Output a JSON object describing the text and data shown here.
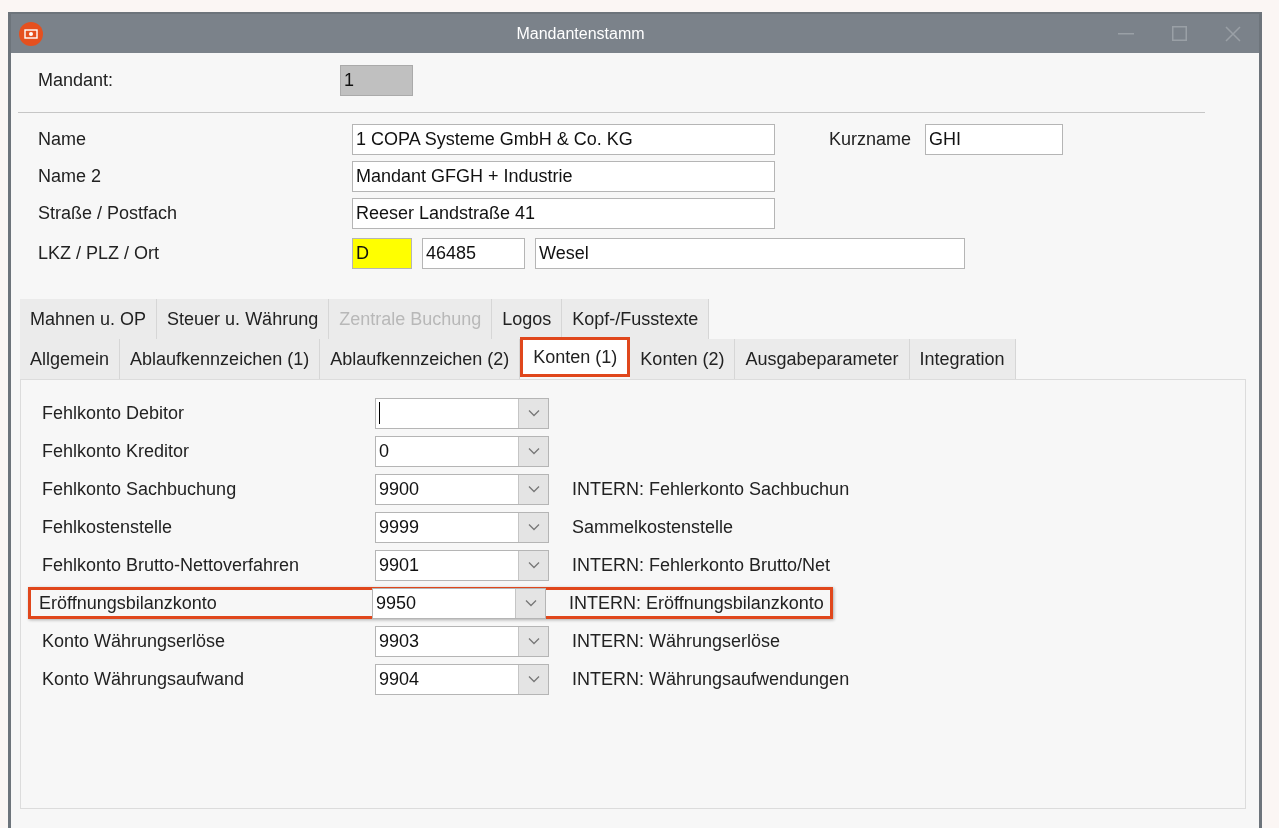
{
  "window": {
    "title": "Mandantenstamm"
  },
  "mandant": {
    "label": "Mandant:",
    "value": "1"
  },
  "address_rows": [
    {
      "label": "Name",
      "inputs": [
        {
          "value": "1 COPA Systeme GmbH & Co. KG",
          "highlighted": false
        }
      ],
      "extra": {
        "label": "Kurzname",
        "value": "GHI"
      }
    },
    {
      "label": "Name 2",
      "inputs": [
        {
          "value": "Mandant GFGH + Industrie",
          "highlighted": false
        }
      ]
    },
    {
      "label": "Straße / Postfach",
      "inputs": [
        {
          "value": "Reeser Landstraße 41",
          "highlighted": false
        }
      ]
    },
    {
      "label": "LKZ / PLZ / Ort",
      "inputs": [
        {
          "value": "D",
          "highlighted": true
        },
        {
          "value": "46485",
          "highlighted": false
        },
        {
          "value": "Wesel",
          "highlighted": false
        }
      ]
    }
  ],
  "tab_rows": [
    [
      {
        "label": "Mahnen u. OP",
        "selected": false,
        "disabled": false
      },
      {
        "label": "Steuer u. Währung",
        "selected": false,
        "disabled": false
      },
      {
        "label": "Zentrale Buchung",
        "selected": false,
        "disabled": true
      },
      {
        "label": "Logos",
        "selected": false,
        "disabled": false
      },
      {
        "label": "Kopf-/Fusstexte",
        "selected": false,
        "disabled": false
      }
    ],
    [
      {
        "label": "Allgemein",
        "selected": false,
        "disabled": false
      },
      {
        "label": "Ablaufkennzeichen (1)",
        "selected": false,
        "disabled": false
      },
      {
        "label": "Ablaufkennzeichen (2)",
        "selected": false,
        "disabled": false
      },
      {
        "label": "Konten (1)",
        "selected": true,
        "disabled": false
      },
      {
        "label": "Konten (2)",
        "selected": false,
        "disabled": false
      },
      {
        "label": "Ausgabeparameter",
        "selected": false,
        "disabled": false
      },
      {
        "label": "Integration",
        "selected": false,
        "disabled": false
      }
    ]
  ],
  "accounts": [
    {
      "label": "Fehlkonto Debitor",
      "focused": true,
      "highlighted": false
    },
    {
      "label": "Fehlkonto Kreditor",
      "value": "0",
      "focused": false,
      "highlighted": false
    },
    {
      "label": "Fehlkonto Sachbuchung",
      "value": "9900",
      "description": "INTERN: Fehlerkonto Sachbuchun",
      "focused": false,
      "highlighted": false
    },
    {
      "label": "Fehlkostenstelle",
      "value": "9999",
      "description": "Sammelkostenstelle",
      "focused": false,
      "highlighted": false
    },
    {
      "label": "Fehlkonto Brutto-Nettoverfahren",
      "value": "9901",
      "description": "INTERN: Fehlerkonto Brutto/Net",
      "focused": false,
      "highlighted": false
    },
    {
      "label": "Eröffnungsbilanzkonto",
      "value": "9950",
      "description": "INTERN: Eröffnungsbilanzkonto",
      "focused": false,
      "highlighted": true
    },
    {
      "label": "Konto Währungserlöse",
      "value": "9903",
      "description": "INTERN: Währungserlöse",
      "focused": false,
      "highlighted": false
    },
    {
      "label": "Konto Währungsaufwand",
      "value": "9904",
      "description": "INTERN: Währungsaufwendungen",
      "focused": false,
      "highlighted": false
    }
  ]
}
